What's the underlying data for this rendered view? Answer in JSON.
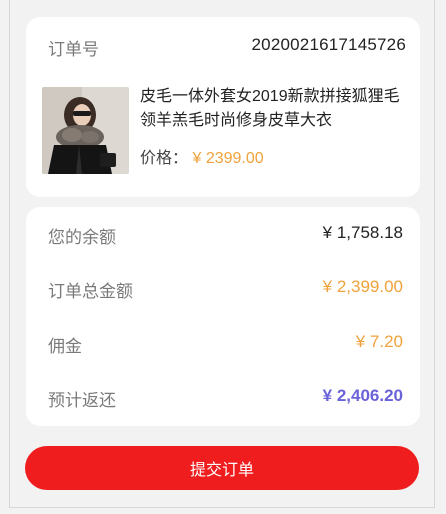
{
  "order": {
    "label": "订单号",
    "number": "2020021617145726"
  },
  "product": {
    "title": "皮毛一体外套女2019新款拼接狐狸毛领羊羔毛时尚修身皮草大衣",
    "price_label": "价格：",
    "price_value": "¥ 2399.00"
  },
  "summary": {
    "rows": [
      {
        "label": "您的余额",
        "value": "¥ 1,758.18"
      },
      {
        "label": "订单总金额",
        "value": "¥ 2,399.00"
      },
      {
        "label": "佣金",
        "value": "¥ 7.20"
      },
      {
        "label": "预计返还",
        "value": "¥ 2,406.20"
      }
    ]
  },
  "actions": {
    "submit_label": "提交订单"
  },
  "colors": {
    "accent_red": "#ef1d1d",
    "price_orange": "#f0a23c",
    "return_purple": "#6a62d8"
  }
}
